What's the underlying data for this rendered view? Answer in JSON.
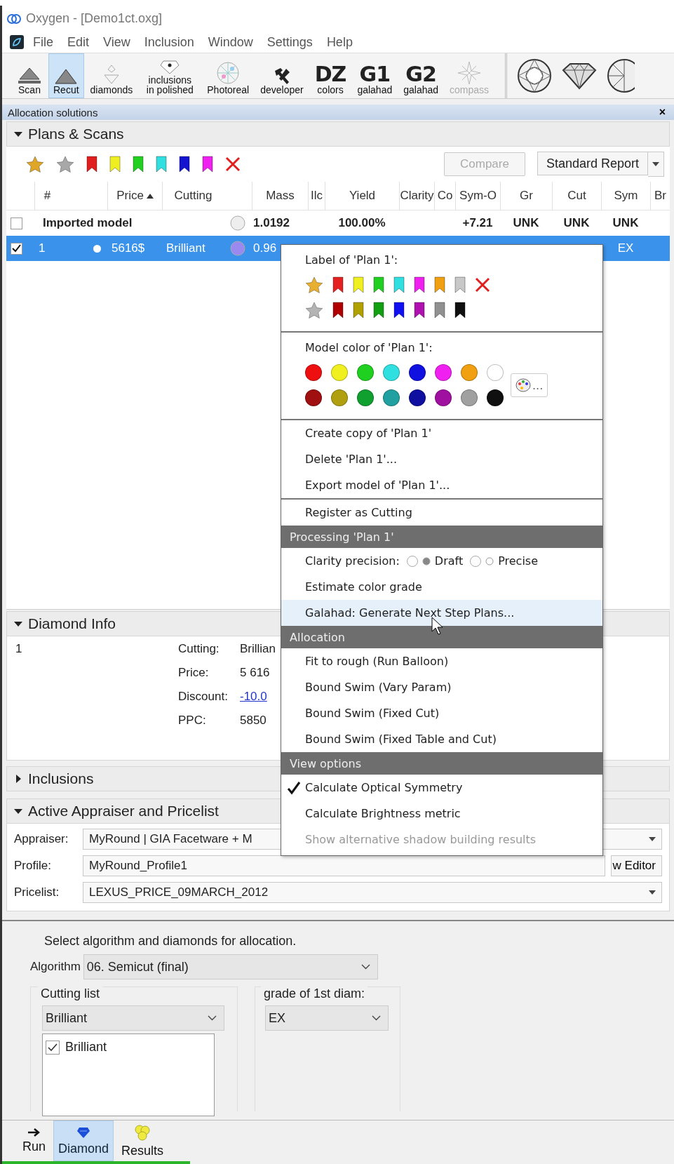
{
  "window": {
    "title": "Oxygen - [Demo1ct.oxg]"
  },
  "menu_bar": [
    "File",
    "Edit",
    "View",
    "Inclusion",
    "Window",
    "Settings",
    "Help"
  ],
  "toolbar": [
    {
      "label": "Scan",
      "kind": "scan",
      "selected": false,
      "disabled": false
    },
    {
      "label": "Recut",
      "kind": "recut",
      "selected": true,
      "disabled": false
    },
    {
      "label": "diamonds",
      "kind": "diamonds",
      "selected": false,
      "disabled": false
    },
    {
      "label": "inclusions in polished",
      "kind": "inclusions",
      "selected": false,
      "disabled": false
    },
    {
      "label": "Photoreal",
      "kind": "photoreal",
      "selected": false,
      "disabled": false
    },
    {
      "label": "developer",
      "kind": "developer",
      "selected": false,
      "disabled": false
    },
    {
      "label": "colors",
      "kind": "glyph",
      "glyph": "DZ",
      "selected": false,
      "disabled": false
    },
    {
      "label": "galahad",
      "kind": "glyph",
      "glyph": "G1",
      "selected": false,
      "disabled": false
    },
    {
      "label": "galahad",
      "kind": "glyph",
      "glyph": "G2",
      "selected": false,
      "disabled": false
    },
    {
      "label": "compass",
      "kind": "compass",
      "selected": false,
      "disabled": true
    }
  ],
  "panel": {
    "title": "Allocation solutions",
    "close": "×"
  },
  "plans": {
    "title": "Plans & Scans",
    "expanded": true,
    "filters": [
      {
        "kind": "star",
        "color": "#e0a628"
      },
      {
        "kind": "star",
        "color": "#a8a8a8"
      },
      {
        "kind": "flag",
        "color": "#e01e1e"
      },
      {
        "kind": "flag",
        "color": "#eeee20"
      },
      {
        "kind": "flag",
        "color": "#22d022"
      },
      {
        "kind": "flag",
        "color": "#30e0e0"
      },
      {
        "kind": "flag",
        "color": "#1414d0"
      },
      {
        "kind": "flag",
        "color": "#f020f0"
      },
      {
        "kind": "clear",
        "color": "#e02020"
      }
    ],
    "compare_button": {
      "label": "Compare",
      "disabled": true
    },
    "report_button": {
      "label": "Standard Report"
    },
    "columns": [
      {
        "label": "#",
        "sorted": false
      },
      {
        "label": "Price",
        "sorted": true
      },
      {
        "label": "Cutting",
        "sorted": false
      },
      {
        "label": "Mass",
        "sorted": false
      },
      {
        "label": "Ilc",
        "sorted": false
      },
      {
        "label": "Yield",
        "sorted": false
      },
      {
        "label": "Clarity",
        "sorted": false
      },
      {
        "label": "Co",
        "sorted": false
      },
      {
        "label": "Sym-O",
        "sorted": false
      },
      {
        "label": "Gr",
        "sorted": false
      },
      {
        "label": "Cut",
        "sorted": false
      },
      {
        "label": "Sym",
        "sorted": false
      },
      {
        "label": "Br",
        "sorted": false
      }
    ],
    "rows": [
      {
        "checked": false,
        "selected": false,
        "name": "Imported model",
        "mass": "1.0192",
        "yield": "100.00%",
        "sym_o": "+7.21",
        "gr": "UNK",
        "cut": "UNK",
        "sym": "UNK",
        "color": "#eeeeee"
      },
      {
        "checked": true,
        "selected": true,
        "number": "1",
        "price": "5616$",
        "cutting": "Brilliant",
        "mass": "0.96",
        "sym": "EX",
        "color": "#9a8af0"
      }
    ]
  },
  "diamond_info": {
    "title": "Diamond Info",
    "expanded": true,
    "number": "1",
    "fields": [
      {
        "label": "Cutting:",
        "value": "Brillian",
        "link": false
      },
      {
        "label": "Price:",
        "value": "5 616",
        "link": false
      },
      {
        "label": "Discount:",
        "value": "-10.0",
        "link": true
      },
      {
        "label": "PPC:",
        "value": "5850",
        "link": false
      }
    ]
  },
  "inclusions": {
    "title": "Inclusions",
    "expanded": false
  },
  "appraiser": {
    "title": "Active Appraiser and Pricelist",
    "expanded": true,
    "fields": [
      {
        "label": "Appraiser:",
        "value": "MyRound | GIA Facetware + M",
        "kind": "dropdown"
      },
      {
        "label": "Profile:",
        "value": "MyRound_Profile1",
        "kind": "editor",
        "button": "w Editor"
      },
      {
        "label": "Pricelist:",
        "value": "LEXUS_PRICE_09MARCH_2012",
        "kind": "dropdown"
      }
    ]
  },
  "allocation": {
    "hint": "Select algorithm and diamonds for allocation.",
    "algorithm_label": "Algorithm",
    "algorithm": "06. Semicut (final)",
    "cutting_list": {
      "title": "Cutting list",
      "value": "Brilliant",
      "items": [
        {
          "label": "Brilliant",
          "checked": true
        }
      ]
    },
    "grade": {
      "title": "grade of 1st diam:",
      "value": "EX"
    }
  },
  "bottom_tabs": [
    {
      "label": "Run",
      "kind": "run",
      "selected": false
    },
    {
      "label": "Diamond",
      "kind": "diamond",
      "selected": true
    },
    {
      "label": "Results",
      "kind": "results",
      "selected": false
    }
  ],
  "progress": {
    "level": 0.28
  },
  "context_menu": {
    "items": [
      {
        "kind": "labels",
        "title": "Label of 'Plan 1':",
        "rows": [
          [
            {
              "kind": "star",
              "color": "#e8b030"
            },
            {
              "kind": "flag",
              "color": "#e42020"
            },
            {
              "kind": "flag",
              "color": "#f0f020"
            },
            {
              "kind": "flag",
              "color": "#20d020"
            },
            {
              "kind": "flag",
              "color": "#30e0e0"
            },
            {
              "kind": "flag",
              "color": "#f020f0"
            },
            {
              "kind": "flag",
              "color": "#f0a010"
            },
            {
              "kind": "flag",
              "color": "#c8c8c8"
            },
            {
              "kind": "clear",
              "color": "#e02020"
            }
          ],
          [
            {
              "kind": "star",
              "color": "#b4b4b4"
            },
            {
              "kind": "flag",
              "color": "#b00000"
            },
            {
              "kind": "flag",
              "color": "#b0a000"
            },
            {
              "kind": "flag",
              "color": "#10a010"
            },
            {
              "kind": "flag",
              "color": "#1010f0"
            },
            {
              "kind": "flag",
              "color": "#b010b0"
            },
            {
              "kind": "flag",
              "color": "#909090"
            },
            {
              "kind": "flag",
              "color": "#101010"
            }
          ]
        ]
      },
      {
        "kind": "separator"
      },
      {
        "kind": "colors",
        "title": "Model color of 'Plan 1':",
        "button": "...",
        "rows": [
          [
            {
              "color": "#ee1010"
            },
            {
              "color": "#f0f020"
            },
            {
              "color": "#20d020"
            },
            {
              "color": "#30e0e0"
            },
            {
              "color": "#1010e0"
            },
            {
              "color": "#f020f0"
            },
            {
              "color": "#f0a010"
            },
            {
              "color": "#ffffff"
            }
          ],
          [
            {
              "color": "#a01010"
            },
            {
              "color": "#b0a010"
            },
            {
              "color": "#10a030"
            },
            {
              "color": "#20a0a0"
            },
            {
              "color": "#1010a0"
            },
            {
              "color": "#a010a0"
            },
            {
              "color": "#a0a0a0"
            },
            {
              "color": "#101010"
            }
          ]
        ]
      },
      {
        "kind": "separator"
      },
      {
        "kind": "item",
        "label": "Create copy of 'Plan 1'",
        "disabled": false,
        "highlighted": false
      },
      {
        "kind": "item",
        "label": "Delete 'Plan 1'...",
        "disabled": false,
        "highlighted": false
      },
      {
        "kind": "item",
        "label": "Export model of 'Plan 1'...",
        "disabled": false,
        "highlighted": false
      },
      {
        "kind": "separator"
      },
      {
        "kind": "item",
        "label": "Register as Cutting",
        "disabled": false,
        "highlighted": false
      },
      {
        "kind": "header",
        "label": "Processing 'Plan 1'"
      },
      {
        "kind": "radio",
        "label": "Clarity precision:",
        "options": [
          {
            "label": "Draft",
            "selected": true
          },
          {
            "label": "Precise",
            "selected": false
          }
        ]
      },
      {
        "kind": "item",
        "label": "Estimate color grade",
        "disabled": false,
        "highlighted": false
      },
      {
        "kind": "item",
        "label": "Galahad: Generate Next Step Plans...",
        "disabled": false,
        "highlighted": true
      },
      {
        "kind": "header",
        "label": "Allocation"
      },
      {
        "kind": "item",
        "label": "Fit to rough (Run Balloon)",
        "disabled": false,
        "highlighted": false
      },
      {
        "kind": "item",
        "label": "Bound Swim (Vary Param)",
        "disabled": false,
        "highlighted": false
      },
      {
        "kind": "item",
        "label": "Bound Swim (Fixed Cut)",
        "disabled": false,
        "highlighted": false
      },
      {
        "kind": "item",
        "label": "Bound Swim (Fixed Table and Cut)",
        "disabled": false,
        "highlighted": false
      },
      {
        "kind": "header",
        "label": "View options"
      },
      {
        "kind": "check",
        "label": "Calculate Optical Symmetry",
        "checked": true
      },
      {
        "kind": "check",
        "label": "Calculate Brightness metric",
        "checked": false
      },
      {
        "kind": "item",
        "label": "Show alternative shadow building results",
        "disabled": true,
        "highlighted": false
      }
    ]
  }
}
